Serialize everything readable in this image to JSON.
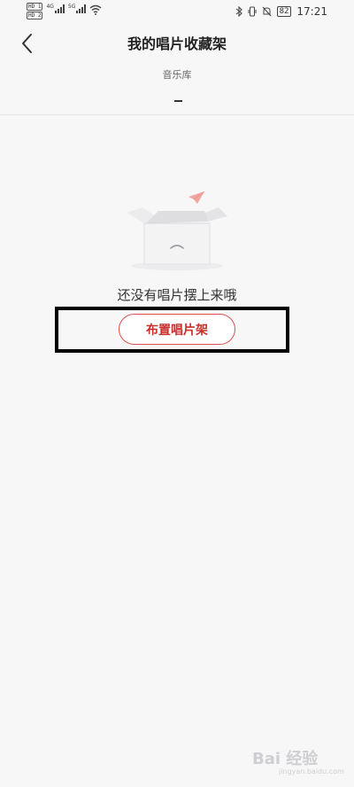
{
  "status_bar": {
    "hd1": "HD 1",
    "hd2": "HD 2",
    "net1": "4G",
    "net2": "5G",
    "battery": "82",
    "time": "17:21"
  },
  "header": {
    "back_icon": "chevron-left-icon",
    "title": "我的唱片收藏架"
  },
  "tabs": [
    {
      "label": "音乐库",
      "active": true
    }
  ],
  "empty_state": {
    "message": "还没有唱片摆上来哦",
    "button_label": "布置唱片架"
  },
  "watermark": {
    "text": "Bai 经验",
    "sub": "jingyan.baidu.com"
  },
  "colors": {
    "accent": "#c9302c",
    "background": "#f7f7f8",
    "highlight_border": "#000000"
  }
}
